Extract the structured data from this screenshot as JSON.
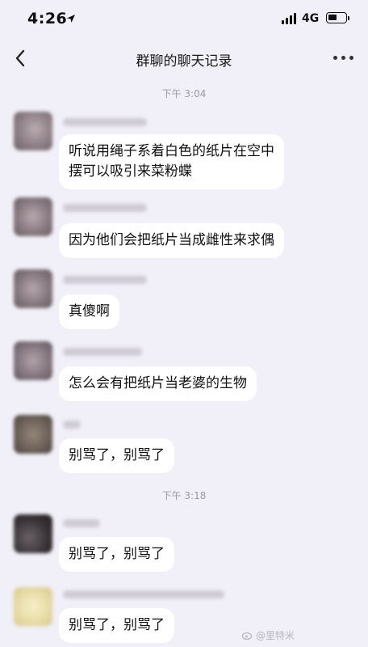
{
  "status_bar": {
    "time": "4:26",
    "network": "4G",
    "icons": [
      "location-arrow-icon",
      "signal-icon",
      "battery-icon"
    ]
  },
  "nav": {
    "title": "群聊的聊天记录",
    "back_icon": "chevron-left-icon",
    "more_icon": "more-dots-icon"
  },
  "chat": {
    "timestamps": [
      "下午 3:04",
      "下午 3:18"
    ],
    "messages": [
      {
        "text_lines": [
          "听说用绳子系着白色的纸片在空中",
          "摆可以吸引来菜粉蝶"
        ],
        "avatar_color": "#8d7f85"
      },
      {
        "text_lines": [
          "因为他们会把纸片当成雌性来求偶"
        ],
        "avatar_color": "#8a7c82"
      },
      {
        "text_lines": [
          "真傻啊"
        ],
        "avatar_color": "#877980"
      },
      {
        "text_lines": [
          "怎么会有把纸片当老婆的生物"
        ],
        "avatar_color": "#857880"
      },
      {
        "text_lines": [
          "别骂了，别骂了"
        ],
        "avatar_color": "#6e625a"
      },
      {
        "text_lines": [
          "别骂了，别骂了"
        ],
        "avatar_color": "#3a3438"
      },
      {
        "text_lines": [
          "别骂了，别骂了"
        ],
        "avatar_color": "#e8dca8"
      }
    ]
  },
  "watermark": {
    "text": "@里特米"
  }
}
